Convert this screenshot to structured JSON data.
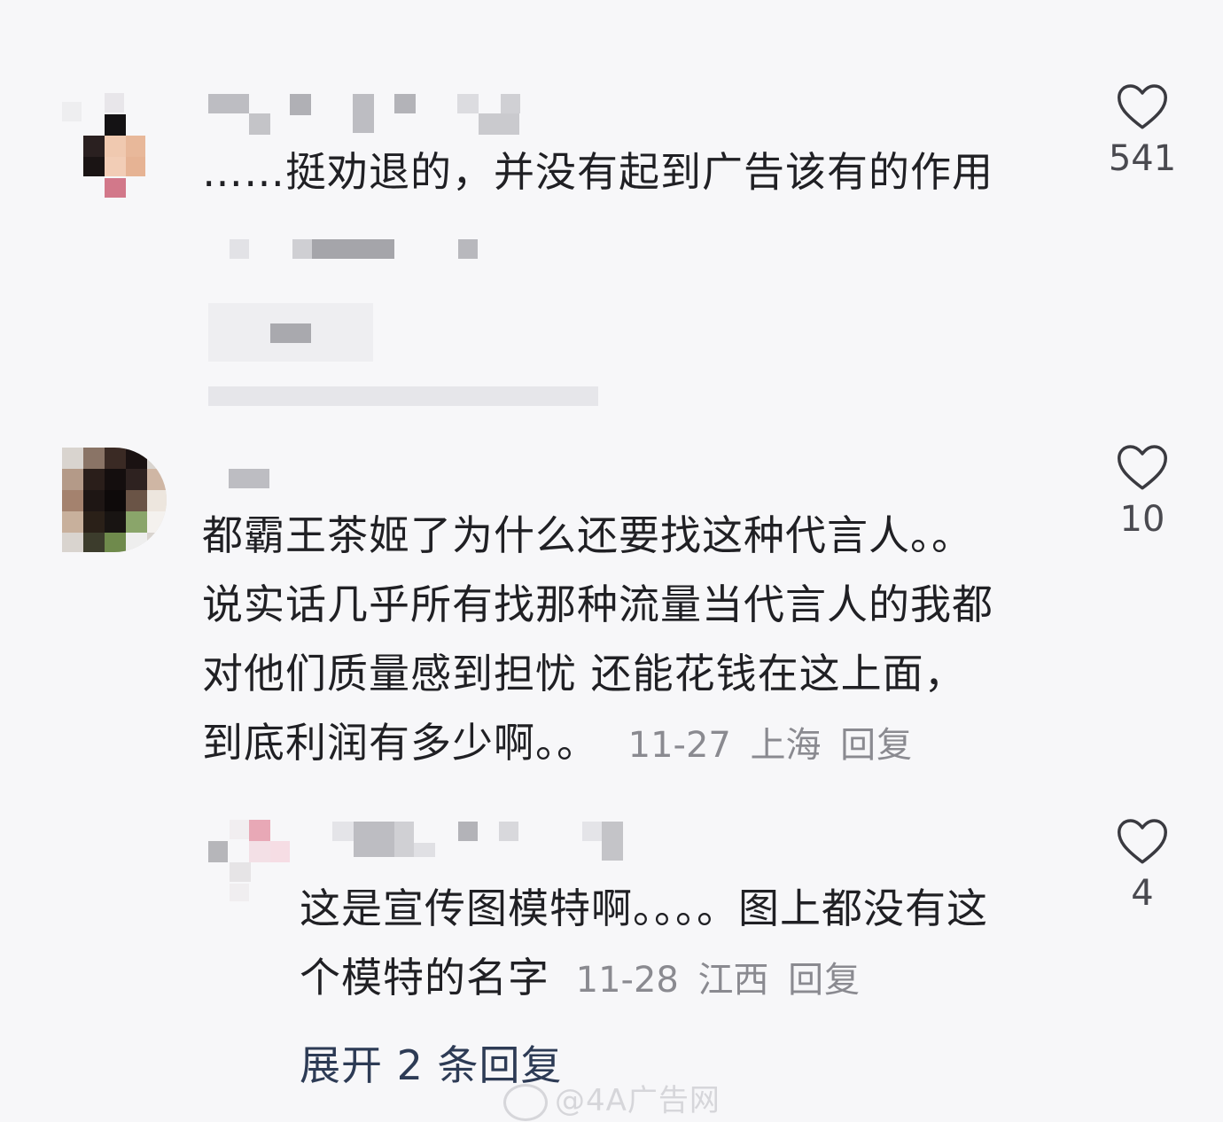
{
  "comments": [
    {
      "text": "……挺劝退的，并没有起到广告该有的作用",
      "likes": "541"
    },
    {
      "text_lines": [
        "都霸王茶姬了为什么还要找这种代言人。。",
        "说实话几乎所有找那种流量当代言人的我都",
        "对他们质量感到担忧 还能花钱在这上面，",
        "到底利润有多少啊。。"
      ],
      "date": "11-27",
      "location": "上海",
      "reply_label": "回复",
      "likes": "10",
      "sub_comment": {
        "text_lines": [
          "这是宣传图模特啊。。。。图上都没有这",
          "个模特的名字"
        ],
        "date": "11-28",
        "location": "江西",
        "reply_label": "回复",
        "likes": "4"
      },
      "expand_label": "展开 2 条回复"
    }
  ],
  "watermark": "@4A广告网",
  "icons": [
    "heart-icon",
    "weibo-icon"
  ]
}
